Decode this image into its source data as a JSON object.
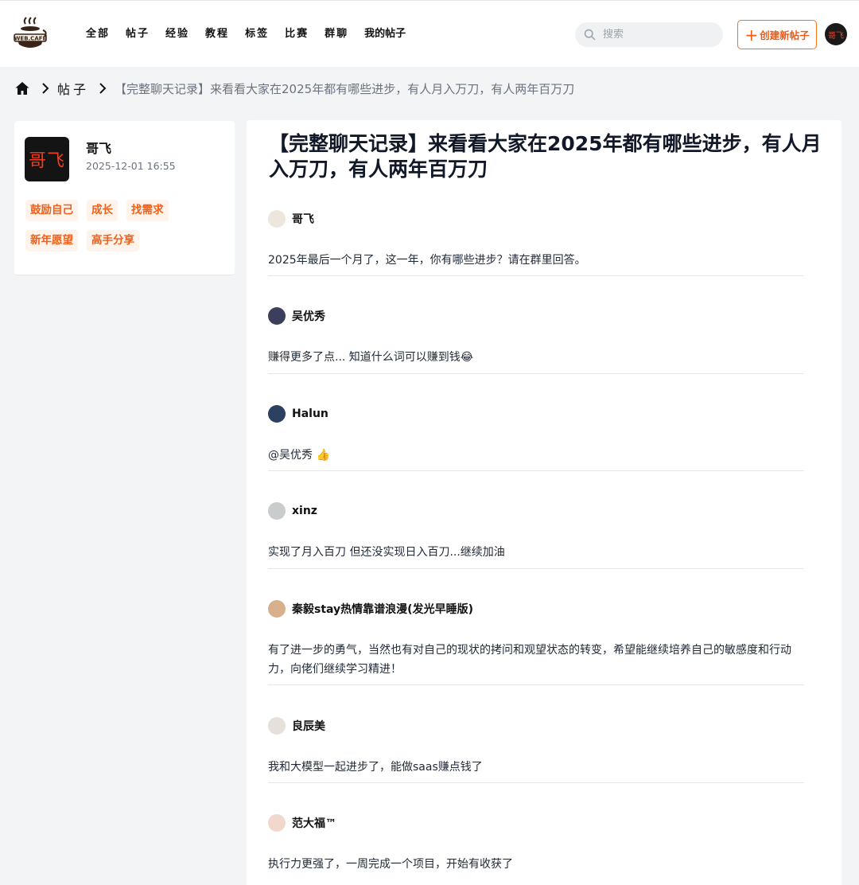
{
  "header": {
    "logo_text": "WEB.CAFE",
    "nav": [
      "全部",
      "帖子",
      "经验",
      "教程",
      "标签",
      "比赛",
      "群聊",
      "我的帖子"
    ],
    "search_placeholder": "搜索",
    "create_button": "创建新帖子",
    "user_avatar_text": "哥飞"
  },
  "breadcrumb": {
    "section": "帖子",
    "current": "【完整聊天记录】来看看大家在2025年都有哪些进步，有人月入万刀，有人两年百万刀"
  },
  "author": {
    "avatar_text": "哥飞",
    "name": "哥飞",
    "date": "2025-12-01 16:55",
    "tags": [
      "鼓励自己",
      "成长",
      "找需求",
      "新年愿望",
      "高手分享"
    ]
  },
  "post": {
    "title": "【完整聊天记录】来看看大家在2025年都有哪些进步，有人月入万刀，有人两年百万刀",
    "messages": [
      {
        "name": "哥飞",
        "text": "2025年最后一个月了，这一年，你有哪些进步？请在群里回答。",
        "avatar_color": "#e8e2d8"
      },
      {
        "name": "吴优秀",
        "text": "赚得更多了点... 知道什么词可以赚到钱😂",
        "avatar_color": "#3b3f5c"
      },
      {
        "name": "Halun",
        "text": "@吴优秀 👍",
        "avatar_color": "#2c4060"
      },
      {
        "name": "xinz",
        "text": "实现了月入百刀 但还没实现日入百刀...继续加油",
        "avatar_color": "#c9cccc"
      },
      {
        "name": "秦毅stay热情靠谱浪漫(发光早睡版)",
        "text": "有了进一步的勇气，当然也有对自己的现状的拷问和观望状态的转变，希望能继续培养自己的敏感度和行动力，向佬们继续学习精进！",
        "avatar_color": "#d8b08c"
      },
      {
        "name": "良辰美",
        "text": "我和大模型一起进步了，能做saas赚点钱了",
        "avatar_color": "#e6e0da"
      },
      {
        "name": "范大福™",
        "text": "执行力更强了，一周完成一个项目，开始有收获了",
        "avatar_color": "#f1d7cc"
      }
    ]
  }
}
